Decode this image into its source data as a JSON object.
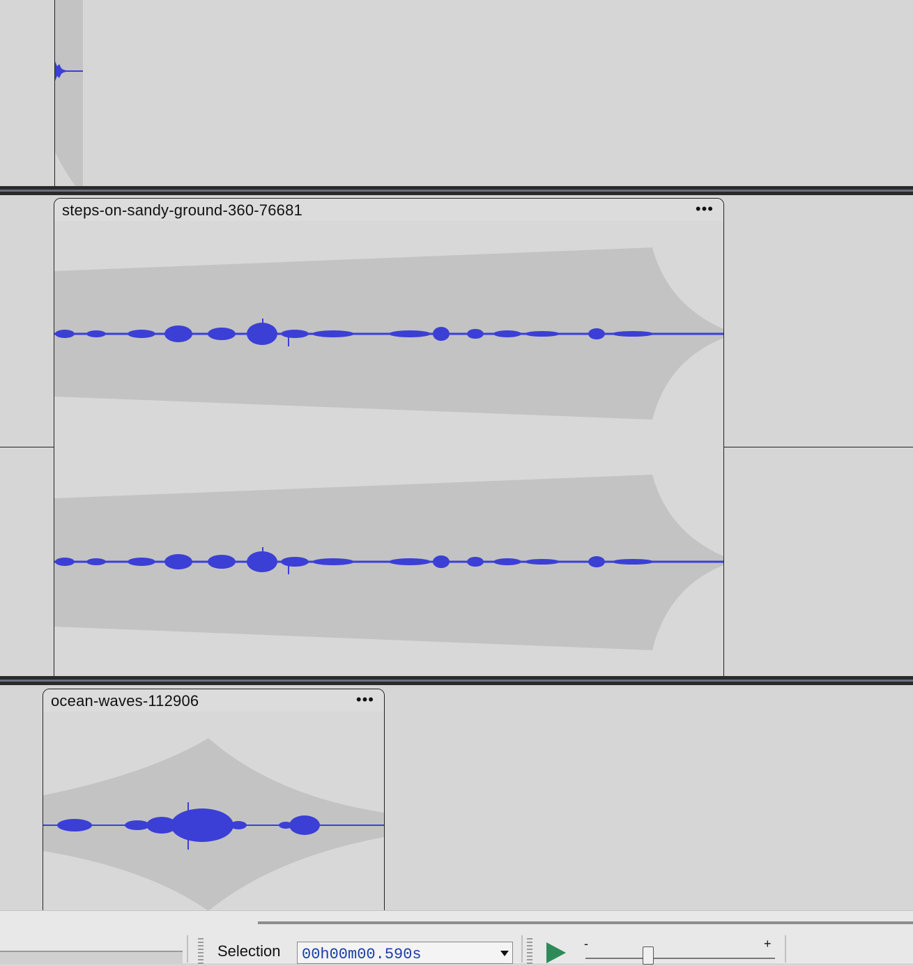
{
  "tracks": [
    {
      "clip_title": "",
      "menu_label": "•••"
    },
    {
      "clip_title": "steps-on-sandy-ground-360-76681",
      "menu_label": "•••"
    },
    {
      "clip_title": "ocean-waves-112906",
      "menu_label": "•••"
    }
  ],
  "toolbar": {
    "selection_label": "Selection",
    "selection_time": "00h00m00.590s",
    "zoom_minus": "-",
    "zoom_plus": "+",
    "zoom_level": 0.33
  },
  "colors": {
    "waveform": "#3b3fd6",
    "envelope": "#c3c3c3",
    "track_bg": "#d6d6d6",
    "separator": "#2a2a2a",
    "play_green": "#2e8b57"
  }
}
